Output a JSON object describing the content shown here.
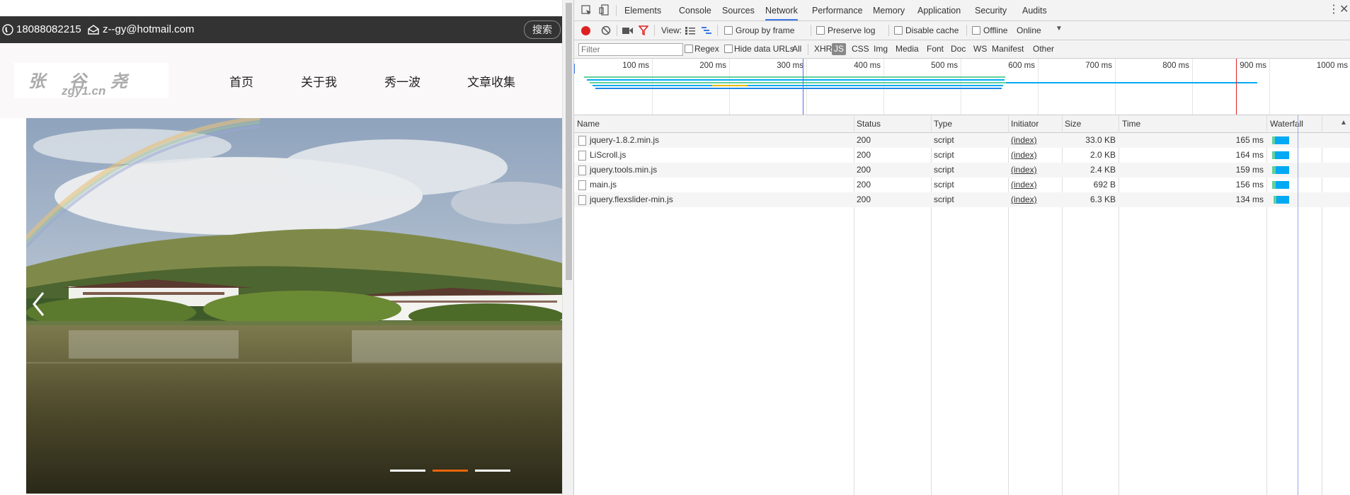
{
  "site": {
    "phone": "18088082215",
    "email": "z--gy@hotmail.com",
    "search_label": "搜索",
    "logo_name": "张谷尧",
    "logo_url": "zgy1.cn",
    "nav": [
      "首页",
      "关于我",
      "秀一波",
      "文章收集"
    ],
    "slider_dots": {
      "count": 3,
      "active_index": 1,
      "active_color": "#e8650a",
      "inactive_color": "#ffffff"
    }
  },
  "devtools": {
    "tabs": [
      "Elements",
      "Console",
      "Sources",
      "Network",
      "Performance",
      "Memory",
      "Application",
      "Security",
      "Audits"
    ],
    "active_tab": "Network",
    "toolbar": {
      "view_label": "View:",
      "group_by_frame": "Group by frame",
      "preserve_log": "Preserve log",
      "disable_cache": "Disable cache",
      "offline": "Offline",
      "throttle_value": "Online"
    },
    "filter": {
      "placeholder": "Filter",
      "regex": "Regex",
      "hide_data_urls": "Hide data URLs",
      "types": [
        "All",
        "XHR",
        "JS",
        "CSS",
        "Img",
        "Media",
        "Font",
        "Doc",
        "WS",
        "Manifest",
        "Other"
      ],
      "active_type": "JS"
    },
    "overview_ticks": [
      "100 ms",
      "200 ms",
      "300 ms",
      "400 ms",
      "500 ms",
      "600 ms",
      "700 ms",
      "800 ms",
      "900 ms",
      "1000 ms"
    ],
    "columns": [
      "Name",
      "Status",
      "Type",
      "Initiator",
      "Size",
      "Time",
      "Waterfall"
    ],
    "requests": [
      {
        "name": "jquery-1.8.2.min.js",
        "status": "200",
        "type": "script",
        "initiator": "(index)",
        "size": "33.0 KB",
        "time": "165 ms"
      },
      {
        "name": "LiScroll.js",
        "status": "200",
        "type": "script",
        "initiator": "(index)",
        "size": "2.0 KB",
        "time": "164 ms"
      },
      {
        "name": "jquery.tools.min.js",
        "status": "200",
        "type": "script",
        "initiator": "(index)",
        "size": "2.4 KB",
        "time": "159 ms"
      },
      {
        "name": "main.js",
        "status": "200",
        "type": "script",
        "initiator": "(index)",
        "size": "692 B",
        "time": "156 ms"
      },
      {
        "name": "jquery.flexslider-min.js",
        "status": "200",
        "type": "script",
        "initiator": "(index)",
        "size": "6.3 KB",
        "time": "134 ms"
      }
    ],
    "colors": {
      "record": "#e02020",
      "waiting": "#61d29b",
      "receiving": "#03a9f4",
      "accent": "#3b78e7"
    }
  }
}
